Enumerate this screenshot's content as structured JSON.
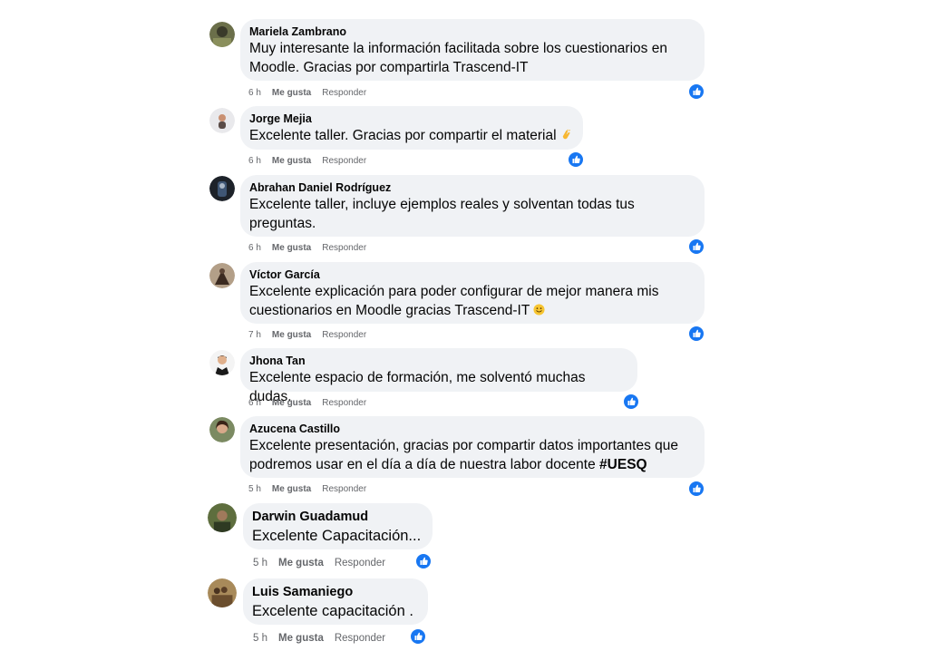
{
  "comments": [
    {
      "author": "Mariela Zambrano",
      "text": "Muy interesante la información facilitada sobre los cuestionarios en Moodle. Gracias por compartirla Trascend-IT",
      "time": "6 h",
      "like_label": "Me gusta",
      "reply_label": "Responder",
      "reaction_icon": "like-icon"
    },
    {
      "author": "Jorge Mejia",
      "text": "Excelente taller. Gracias por compartir el material",
      "emoji": "clapping-hands-emoji",
      "time": "6 h",
      "like_label": "Me gusta",
      "reply_label": "Responder",
      "reaction_icon": "like-icon"
    },
    {
      "author": "Abrahan Daniel Rodríguez",
      "text": "Excelente taller, incluye ejemplos reales y solventan todas tus preguntas.",
      "time": "6 h",
      "like_label": "Me gusta",
      "reply_label": "Responder",
      "reaction_icon": "like-icon"
    },
    {
      "author": "Víctor García",
      "text": "Excelente explicación para poder configurar de mejor manera mis cuestionarios en Moodle gracias Trascend-IT",
      "emoji": "smiling-face-emoji",
      "time": "7 h",
      "like_label": "Me gusta",
      "reply_label": "Responder",
      "reaction_icon": "like-icon"
    },
    {
      "author": "Jhona Tan",
      "text": "Excelente espacio de formación, me solventó muchas dudas.",
      "time": "6 h",
      "like_label": "Me gusta",
      "reply_label": "Responder",
      "reaction_icon": "like-icon"
    },
    {
      "author": "Azucena Castillo",
      "text": "Excelente presentación, gracias por compartir datos importantes que podremos usar en el día a día de nuestra labor docente",
      "hashtag": "#UESQ",
      "time": "5 h",
      "like_label": "Me gusta",
      "reply_label": "Responder",
      "reaction_icon": "like-icon"
    },
    {
      "author": "Darwin Guadamud",
      "text": "Excelente Capacitación...",
      "time": "5 h",
      "like_label": "Me gusta",
      "reply_label": "Responder",
      "reaction_icon": "like-icon"
    },
    {
      "author": "Luis Samaniego",
      "text": "Excelente capacitación .",
      "time": "5 h",
      "like_label": "Me gusta",
      "reply_label": "Responder",
      "reaction_icon": "like-icon"
    }
  ],
  "colors": {
    "bubble": "#f0f2f5",
    "like_blue": "#1877f2",
    "meta_gray": "#65676b"
  }
}
